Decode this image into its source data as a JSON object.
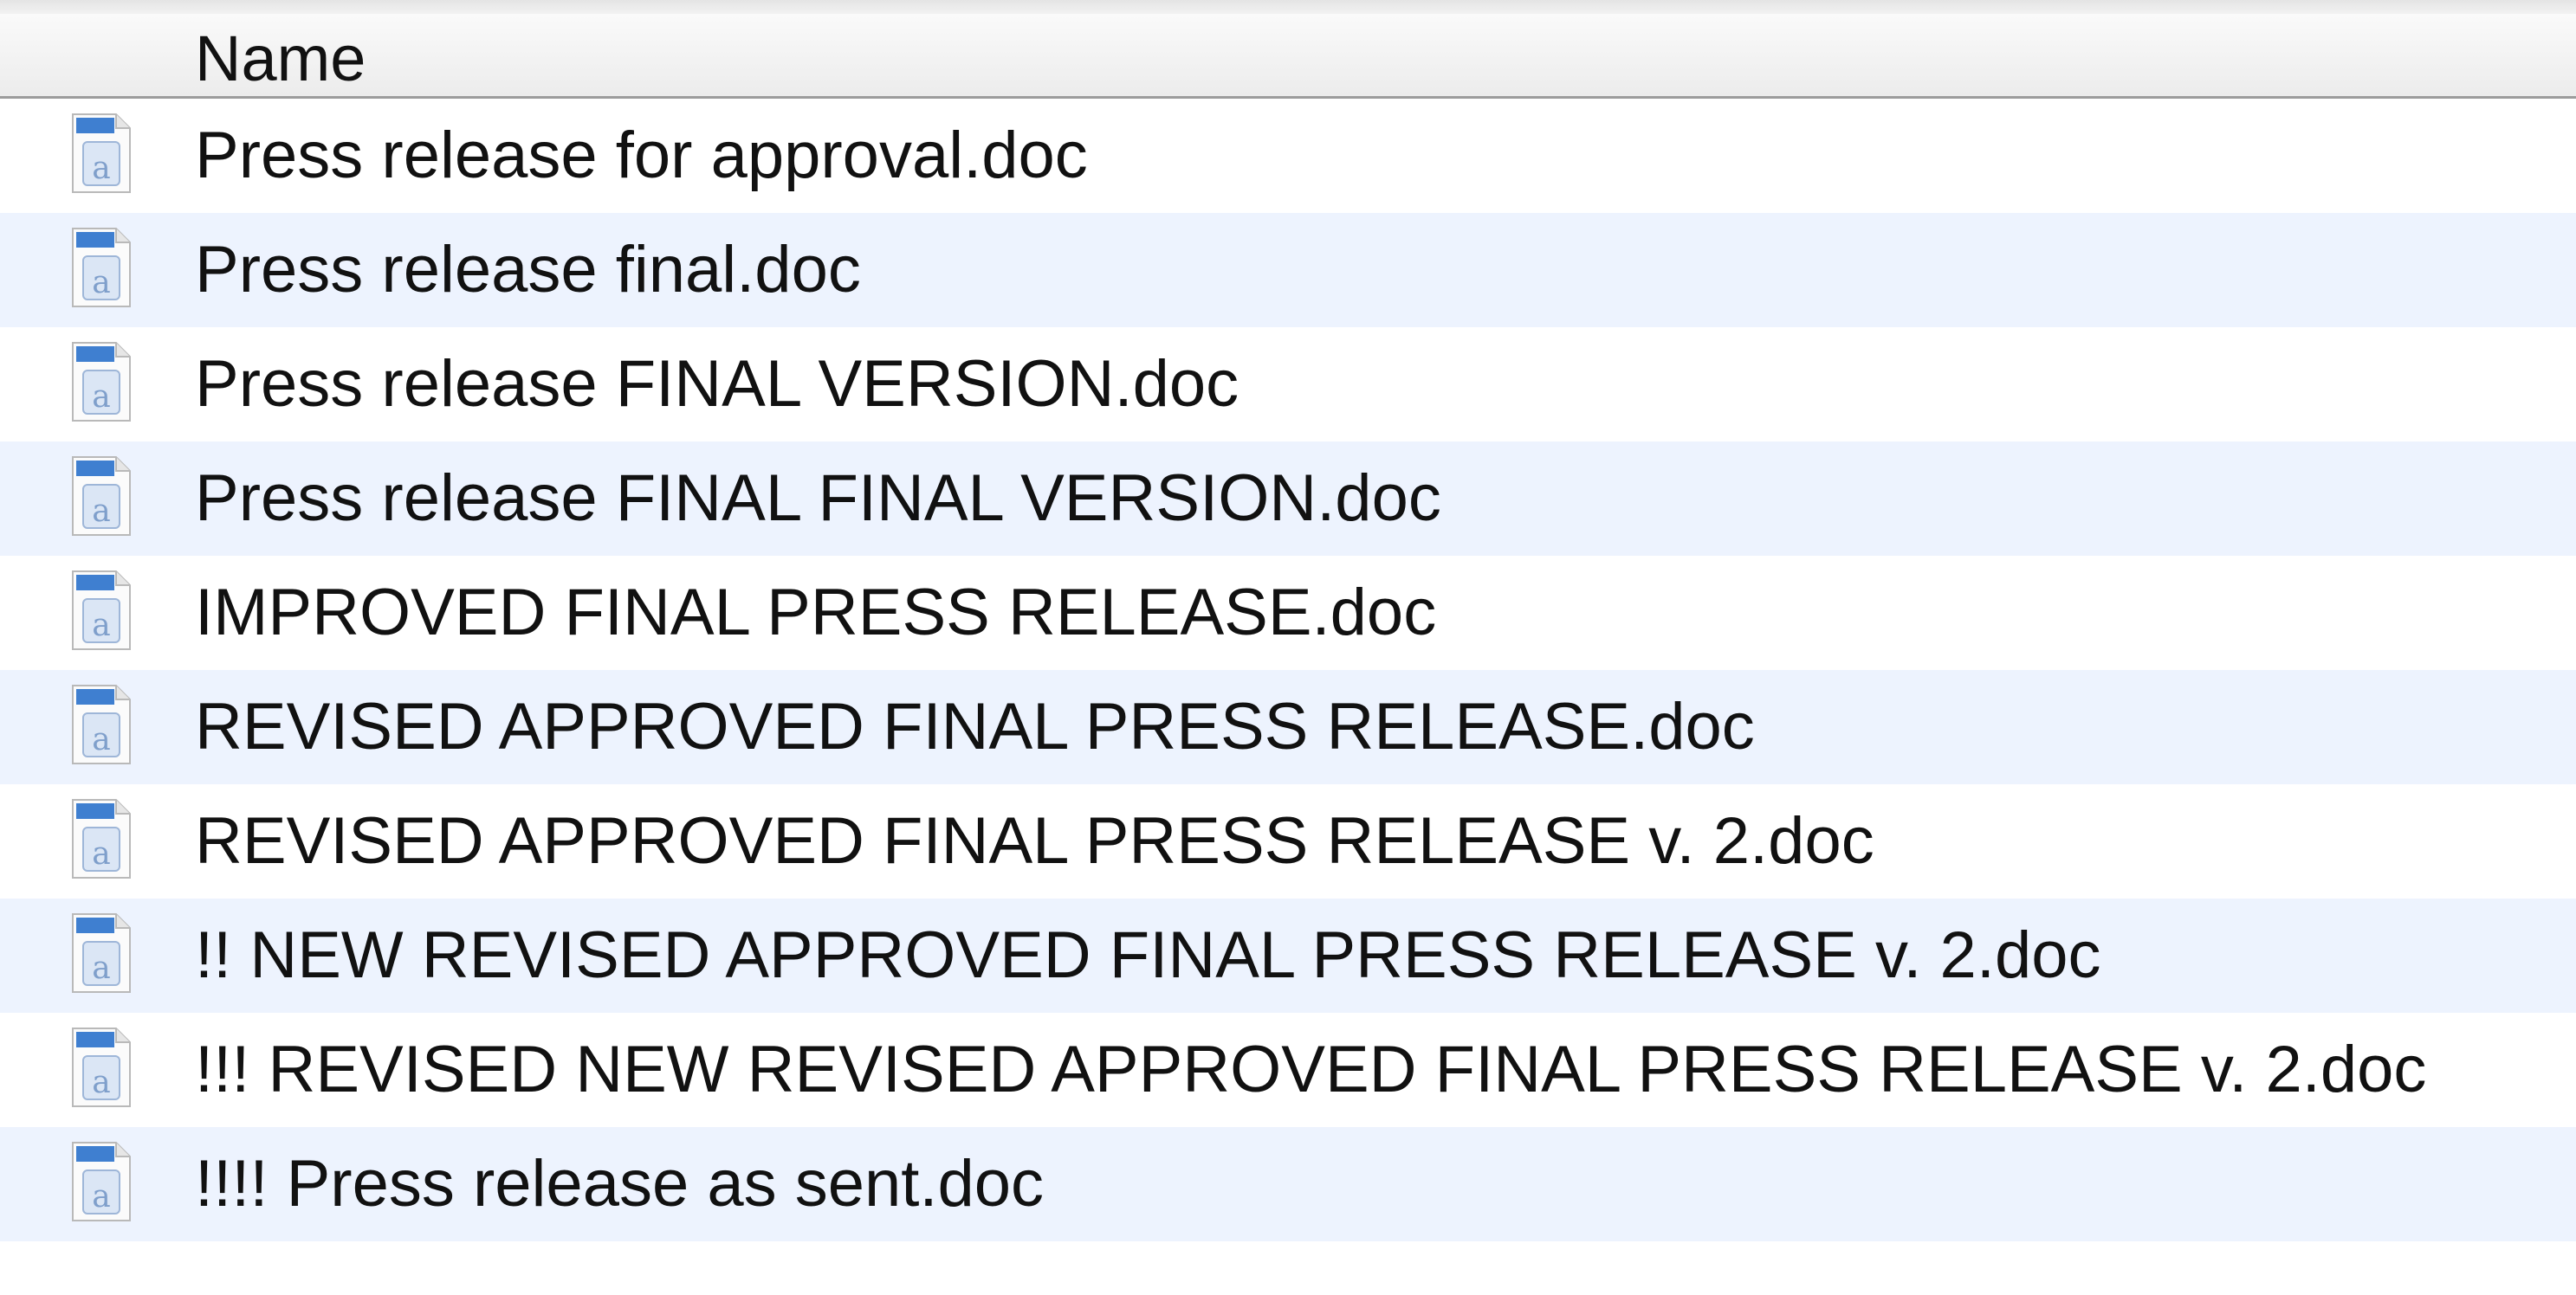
{
  "header": {
    "name_label": "Name"
  },
  "files": [
    {
      "name": "Press release for approval.doc",
      "icon": "word-document-icon"
    },
    {
      "name": "Press release final.doc",
      "icon": "word-document-icon"
    },
    {
      "name": "Press release FINAL VERSION.doc",
      "icon": "word-document-icon"
    },
    {
      "name": "Press release FINAL FINAL VERSION.doc",
      "icon": "word-document-icon"
    },
    {
      "name": "IMPROVED FINAL PRESS RELEASE.doc",
      "icon": "word-document-icon"
    },
    {
      "name": "REVISED APPROVED FINAL PRESS RELEASE.doc",
      "icon": "word-document-icon"
    },
    {
      "name": "REVISED APPROVED FINAL PRESS RELEASE v. 2.doc",
      "icon": "word-document-icon"
    },
    {
      "name": "!! NEW REVISED APPROVED FINAL PRESS RELEASE v. 2.doc",
      "icon": "word-document-icon"
    },
    {
      "name": "!!! REVISED NEW REVISED APPROVED FINAL PRESS RELEASE v. 2.doc",
      "icon": "word-document-icon"
    },
    {
      "name": "!!!! Press release as sent.doc",
      "icon": "word-document-icon"
    }
  ],
  "colors": {
    "alternate_row": "#edf3fe",
    "header_border": "#9c9c9c",
    "icon_blue": "#3f7fd0"
  }
}
